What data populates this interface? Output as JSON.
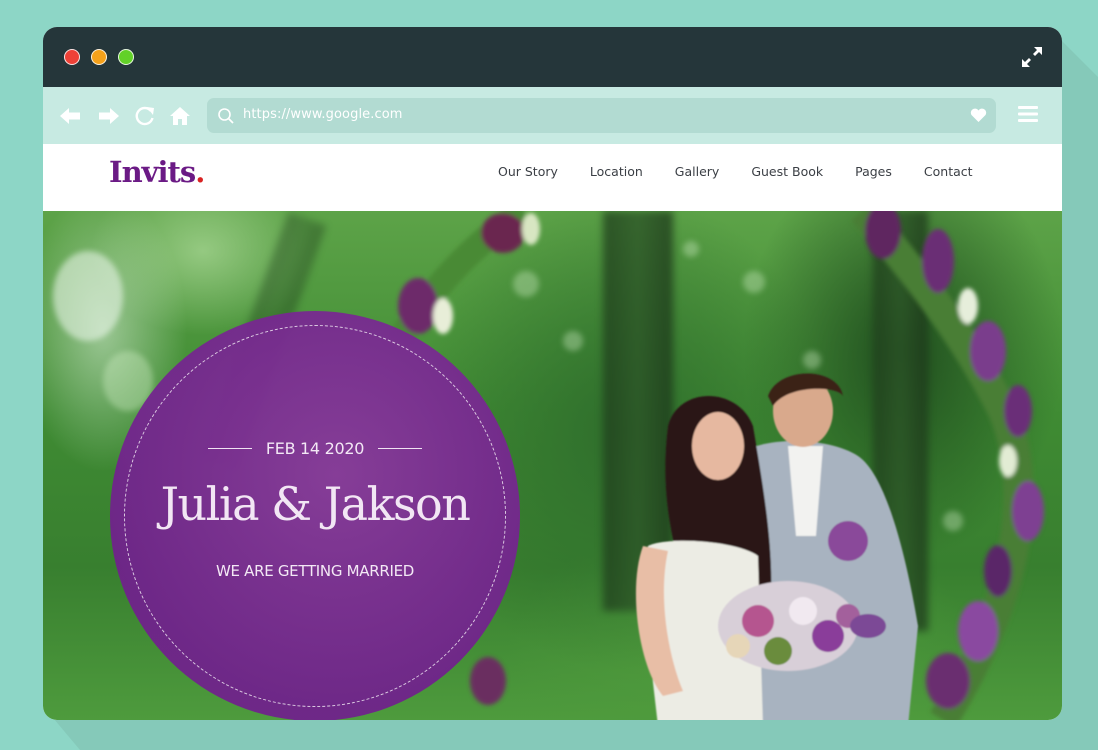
{
  "browser": {
    "window_controls": [
      "close",
      "minimize",
      "maximize"
    ],
    "expand_icon": "expand-arrows-icon",
    "nav_icons": [
      "back-arrow-icon",
      "forward-arrow-icon",
      "reload-icon",
      "home-icon"
    ],
    "url": "https://www.google.com",
    "search_icon": "search-icon",
    "bookmark_icon": "heart-icon",
    "menu_icon": "hamburger-menu-icon"
  },
  "site": {
    "logo": "Invits",
    "logo_dot": ".",
    "nav": [
      "Our Story",
      "Location",
      "Gallery",
      "Guest Book",
      "Pages",
      "Contact"
    ]
  },
  "hero": {
    "date": "FEB 14 2020",
    "names": "Julia & Jakson",
    "tagline": "WE ARE GETTING MARRIED",
    "image_alt": "Bride and groom embracing under a lilac flower arch in a green forest"
  },
  "colors": {
    "background": "#8dd6c6",
    "titlebar": "#25363a",
    "toolbar": "#c7eae2",
    "urlbar": "#b2dbd2",
    "logo": "#6b1a85",
    "logo_dot": "#d92323",
    "circle": "#7a2595"
  }
}
